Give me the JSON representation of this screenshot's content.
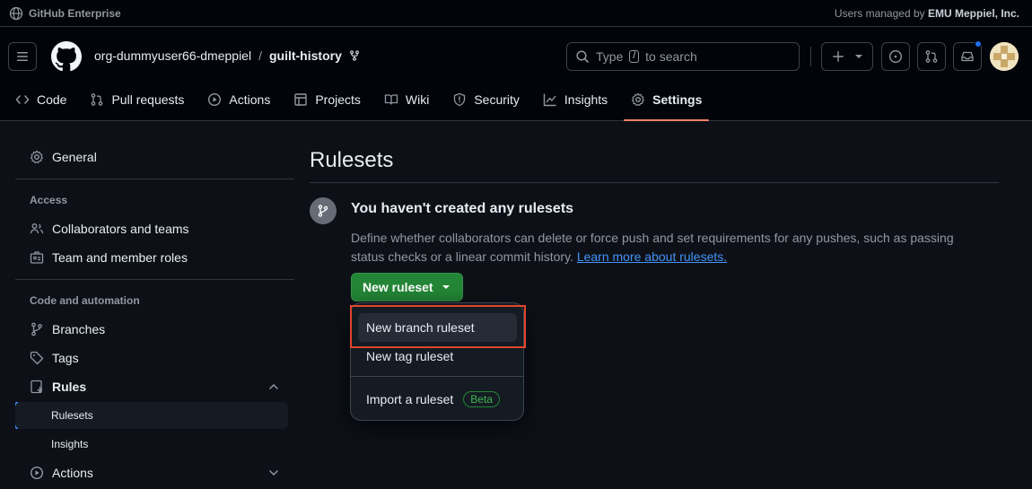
{
  "topbar": {
    "product": "GitHub Enterprise",
    "managed_prefix": "Users managed by",
    "managed_org": "EMU Meppiel, Inc."
  },
  "header": {
    "org": "org-dummyuser66-dmeppiel",
    "separator": "/",
    "repo": "guilt-history",
    "search": {
      "prefix": "Type",
      "key": "/",
      "suffix": "to search"
    }
  },
  "tabs": [
    {
      "label": "Code",
      "icon": "code-icon"
    },
    {
      "label": "Pull requests",
      "icon": "pull-request-icon"
    },
    {
      "label": "Actions",
      "icon": "play-icon"
    },
    {
      "label": "Projects",
      "icon": "table-icon"
    },
    {
      "label": "Wiki",
      "icon": "book-icon"
    },
    {
      "label": "Security",
      "icon": "shield-icon"
    },
    {
      "label": "Insights",
      "icon": "graph-icon"
    },
    {
      "label": "Settings",
      "icon": "gear-icon",
      "active": true
    }
  ],
  "sidebar": {
    "general": "General",
    "access_heading": "Access",
    "collaborators": "Collaborators and teams",
    "member_roles": "Team and member roles",
    "code_heading": "Code and automation",
    "branches": "Branches",
    "tags": "Tags",
    "rules": "Rules",
    "rulesets": "Rulesets",
    "insights": "Insights",
    "actions": "Actions"
  },
  "main": {
    "title": "Rulesets",
    "empty_title": "You haven't created any rulesets",
    "empty_desc": "Define whether collaborators can delete or force push and set requirements for any pushes, such as passing status checks or a linear commit history.",
    "learn_more": "Learn more about rulesets.",
    "new_button": "New ruleset"
  },
  "menu": {
    "items": [
      "New branch ruleset",
      "New tag ruleset",
      "Import a ruleset"
    ],
    "beta": "Beta"
  },
  "colors": {
    "accent": "#f78166",
    "primary_button": "#238636",
    "link": "#4493f8",
    "highlight_box": "#e2462b"
  }
}
